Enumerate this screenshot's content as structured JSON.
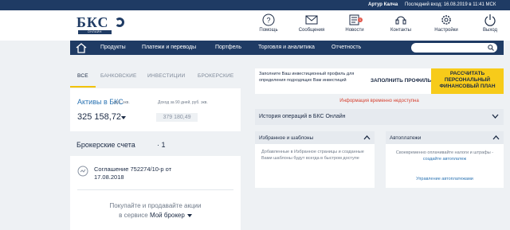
{
  "top_bar": {
    "user": "Артур Калча",
    "last_login": "Последний вход: 16.08.2019 в 11:41 МСК"
  },
  "logo": {
    "text": "БКС",
    "sub": "ОНЛАЙН"
  },
  "header_icons": [
    {
      "label": "Помощь",
      "icon": "help-icon"
    },
    {
      "label": "Сообщения",
      "icon": "messages-icon"
    },
    {
      "label": "Новости",
      "icon": "news-icon",
      "badge": "1"
    },
    {
      "label": "Контакты",
      "icon": "contacts-icon"
    },
    {
      "label": "Настройки",
      "icon": "settings-icon"
    },
    {
      "label": "Выход",
      "icon": "exit-icon"
    }
  ],
  "nav": {
    "items": [
      "Продукты",
      "Платежи и переводы",
      "Портфель",
      "Торговля и аналитика",
      "Отчетность"
    ]
  },
  "tabs": [
    "ВСЕ",
    "БАНКОВСКИЕ",
    "ИНВЕСТИЦИИ",
    "БРОКЕРСКИЕ"
  ],
  "assets": {
    "title": "Активы в БКС",
    "unit": "руб. экв.",
    "income_label": "Доход за 90 дней, руб. экв.",
    "value": "325 158,72",
    "income_value": "379 180,49"
  },
  "brokerage": {
    "title": "Брокерские счета",
    "count": "· 1",
    "agreement": "Соглашение 752274/10-р от 17.08.2018",
    "promo_line1": "Покупайте и продавайте акции",
    "promo_line2": "в сервисе",
    "promo_link": "Мой брокер"
  },
  "invest_banner": {
    "text": "Заполните Ваш инвестиционный профиль для определения подходящих Вам инвестиций",
    "fill_button": "ЗАПОЛНИТЬ ПРОФИЛЬ",
    "plan_button": "РАССЧИТАТЬ ПЕРСОНАЛЬНЫЙ ФИНАНСОВЫЙ ПЛАН"
  },
  "unavailable": "Информация временно недоступна",
  "history": {
    "title": "История операций в БКС Онлайн"
  },
  "favorites": {
    "title": "Избранное и шаблоны",
    "text": "Добавленные в Избранное страницы и созданные Вами шаблоны будут всегда в быстром доступе"
  },
  "autopay": {
    "title": "Автоплатежи",
    "text": "Своевременно оплачивайте налоги и штрафы -",
    "text_link": "создайте автоплатеж",
    "manage_link": "Управление автоплатежами"
  },
  "colors": {
    "brand": "#1f3b64",
    "accent": "#f7cb1a",
    "link": "#2c74b3",
    "error": "#d6402f"
  }
}
